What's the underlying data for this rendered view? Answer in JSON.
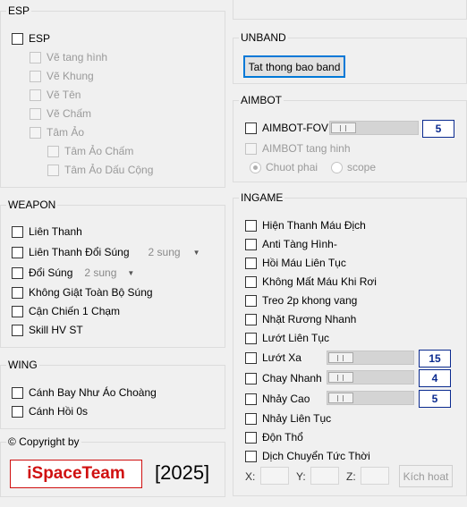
{
  "esp": {
    "legend": "ESP",
    "main": "ESP",
    "items": [
      "Vẽ tang hình",
      "Vẽ Khung",
      "Vẽ Tên",
      "Vẽ Chấm",
      "Tâm Ảo"
    ],
    "sub_items": [
      "Tâm Ảo Chấm",
      "Tâm Ảo Dấu Cộng"
    ]
  },
  "weapon": {
    "legend": "WEAPON",
    "items": [
      "Liên Thanh",
      "Liên Thanh Đổi Súng",
      "Đổi Súng",
      "Không Giật Toàn Bộ Súng",
      "Cận Chiến 1 Chạm",
      "Skill HV ST"
    ],
    "combo1": "2 sung",
    "combo2": "2 sung"
  },
  "wing": {
    "legend": "WING",
    "items": [
      "Cánh Bay Như Áo Choàng",
      "Cánh Hồi 0s"
    ]
  },
  "copyright": {
    "label": "© Copyright by",
    "brand": "iSpaceTeam",
    "year": "[2025]",
    "brand_color": "#d01010"
  },
  "unband": {
    "legend": "UNBAND",
    "button": "Tat thong bao band"
  },
  "aimbot": {
    "legend": "AIMBOT",
    "fov_label": "AIMBOT-FOV",
    "fov_value": "5",
    "stealth_label": "AIMBOT tang hinh",
    "radio1": "Chuot phai",
    "radio2": "scope"
  },
  "ingame": {
    "legend": "INGAME",
    "items": [
      "Hiện Thanh Máu Địch",
      "Anti Tàng Hình-",
      "Hồi Máu Liên Tục",
      "Không Mất Máu Khi Rơi",
      "Treo 2p khong vang",
      "Nhặt Rương Nhanh",
      "Lướt Liên Tục"
    ],
    "slider_items": [
      {
        "label": "Lướt Xa",
        "value": "15"
      },
      {
        "label": "Chay Nhanh",
        "value": "4"
      },
      {
        "label": "Nhảy Cao",
        "value": "5"
      }
    ],
    "items2": [
      "Nhảy Liên Tục",
      "Độn Thổ",
      "Dịch Chuyển Tức Thời"
    ],
    "x_label": "X:",
    "y_label": "Y:",
    "z_label": "Z:",
    "activate_button": "Kích hoat"
  }
}
